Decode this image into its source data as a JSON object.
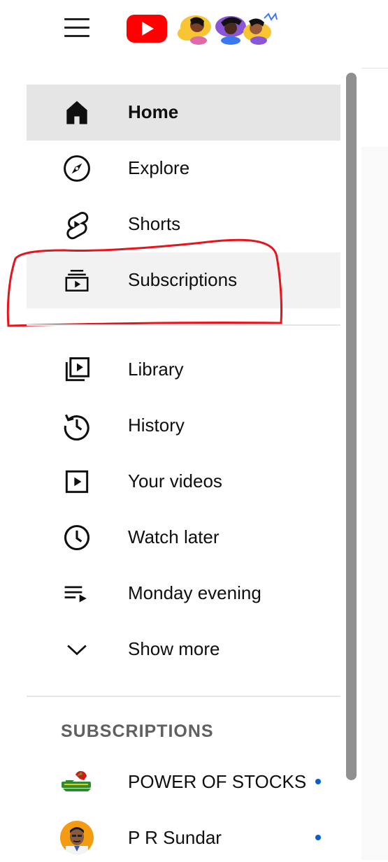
{
  "header": {
    "menu_icon": "hamburger-menu-icon",
    "logo": "youtube-logo"
  },
  "nav_primary": [
    {
      "id": "home",
      "label": "Home",
      "icon": "home-icon",
      "active": true
    },
    {
      "id": "explore",
      "label": "Explore",
      "icon": "compass-icon"
    },
    {
      "id": "shorts",
      "label": "Shorts",
      "icon": "shorts-icon"
    },
    {
      "id": "subscriptions",
      "label": "Subscriptions",
      "icon": "subscriptions-icon",
      "highlighted": true
    }
  ],
  "nav_library": [
    {
      "id": "library",
      "label": "Library",
      "icon": "library-icon"
    },
    {
      "id": "history",
      "label": "History",
      "icon": "history-icon"
    },
    {
      "id": "your-videos",
      "label": "Your videos",
      "icon": "play-icon"
    },
    {
      "id": "watch-later",
      "label": "Watch later",
      "icon": "clock-icon"
    },
    {
      "id": "playlist",
      "label": "Monday evening",
      "icon": "playlist-icon"
    },
    {
      "id": "show-more",
      "label": "Show more",
      "icon": "chevron-down-icon"
    }
  ],
  "subscriptions_section": {
    "title": "SUBSCRIPTIONS",
    "channels": [
      {
        "name": "POWER OF STOCKS",
        "new_content": true
      },
      {
        "name": "P R Sundar",
        "new_content": true
      }
    ]
  },
  "colors": {
    "brand_red": "#ff0000",
    "active_bg": "#e5e5e5",
    "dot_blue": "#065fd4",
    "annotation_red": "#e8141c"
  }
}
